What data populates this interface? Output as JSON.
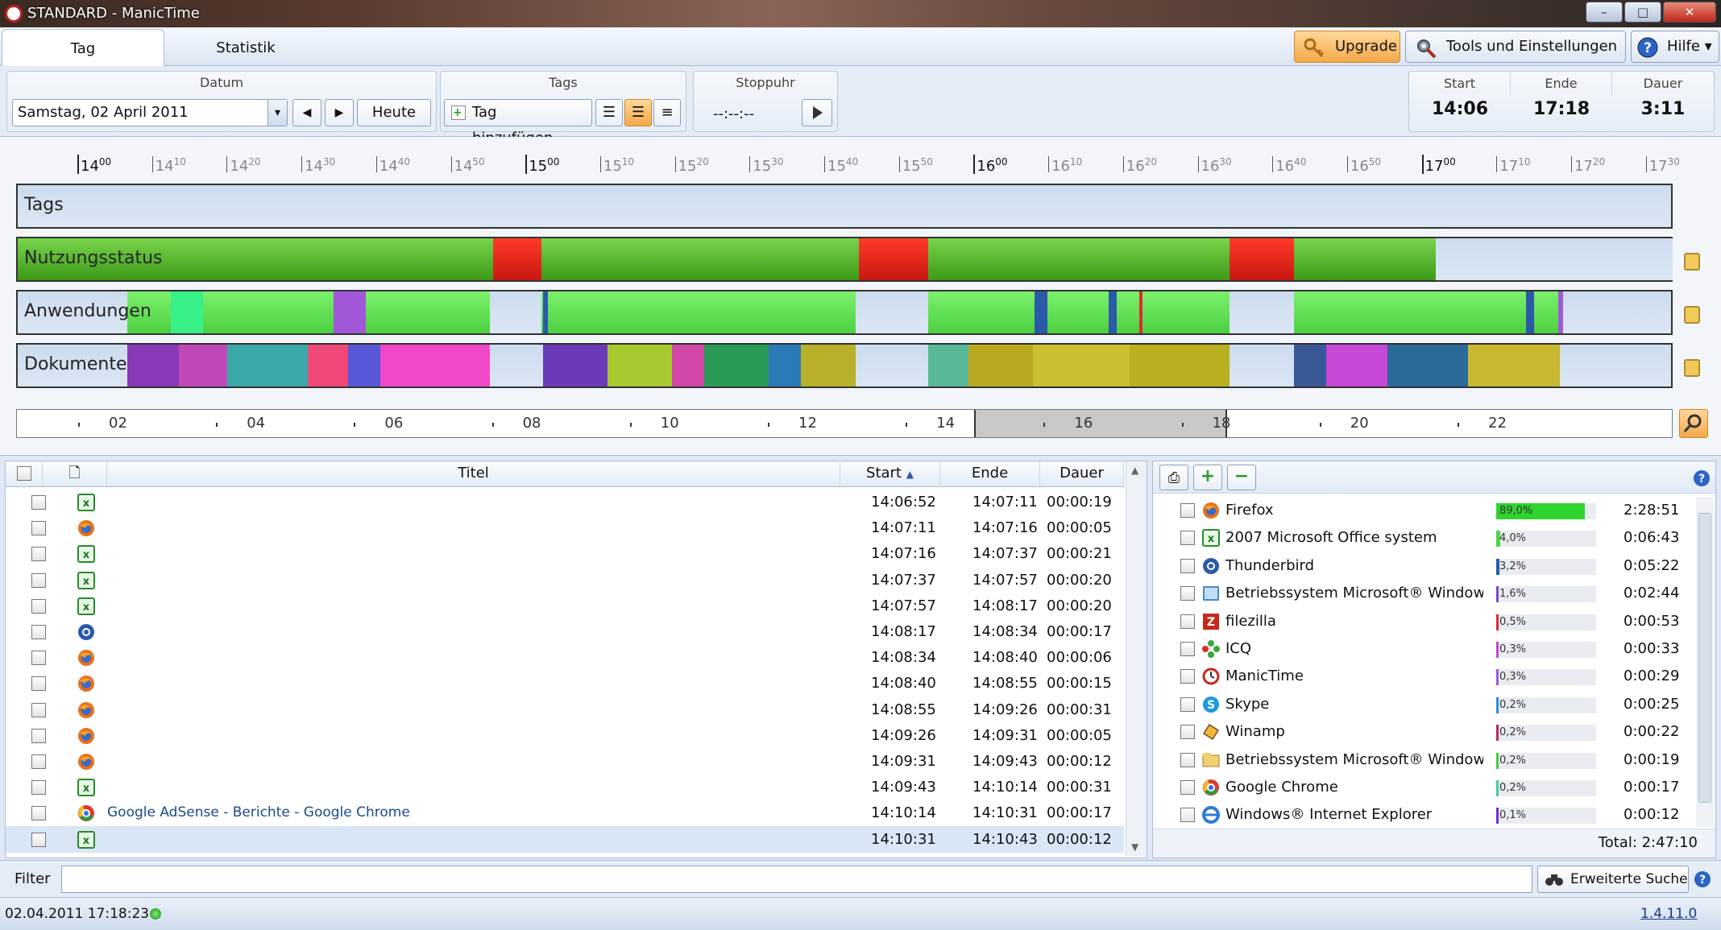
{
  "window": {
    "title": "STANDARD - ManicTime",
    "minimize": "–",
    "maximize": "□",
    "close": "✕"
  },
  "menu": {
    "tabs": [
      {
        "label": "Tag"
      },
      {
        "label": "Statistik"
      }
    ],
    "upgrade_label": "Upgrade",
    "tools_label": "Tools und Einstellungen",
    "help_label": "Hilfe",
    "dropdown_arrow": "▾"
  },
  "toolbar": {
    "datum_title": "Datum",
    "date_value": "Samstag, 02 April 2011",
    "prev": "◀",
    "next": "▶",
    "today_label": "Heute",
    "tags_title": "Tags",
    "add_tag_label": "Tag hinzufügen...",
    "stopwatch_title": "Stoppuhr",
    "stopwatch_value": "--:--:--",
    "summary": {
      "start_label": "Start",
      "start_value": "14:06",
      "end_label": "Ende",
      "end_value": "17:18",
      "duration_label": "Dauer",
      "duration_value": "3:11"
    }
  },
  "timeline": {
    "ticks": [
      {
        "h": "14",
        "m": "00",
        "major": true
      },
      {
        "h": "14",
        "m": "10"
      },
      {
        "h": "14",
        "m": "20"
      },
      {
        "h": "14",
        "m": "30"
      },
      {
        "h": "14",
        "m": "40"
      },
      {
        "h": "14",
        "m": "50"
      },
      {
        "h": "15",
        "m": "00",
        "major": true
      },
      {
        "h": "15",
        "m": "10"
      },
      {
        "h": "15",
        "m": "20"
      },
      {
        "h": "15",
        "m": "30"
      },
      {
        "h": "15",
        "m": "40"
      },
      {
        "h": "15",
        "m": "50"
      },
      {
        "h": "16",
        "m": "00",
        "major": true
      },
      {
        "h": "16",
        "m": "10"
      },
      {
        "h": "16",
        "m": "20"
      },
      {
        "h": "16",
        "m": "30"
      },
      {
        "h": "16",
        "m": "40"
      },
      {
        "h": "16",
        "m": "50"
      },
      {
        "h": "17",
        "m": "00",
        "major": true
      },
      {
        "h": "17",
        "m": "10"
      },
      {
        "h": "17",
        "m": "20"
      },
      {
        "h": "17",
        "m": "30"
      }
    ],
    "rows": {
      "tags": "Tags",
      "usage": "Nutzungsstatus",
      "apps": "Anwendungen",
      "docs": "Dokumente"
    },
    "colors": {
      "active": "#5cbf2a",
      "away": "#e8261c",
      "app_green": "#5fe05a"
    },
    "day_ruler": [
      "02",
      "04",
      "06",
      "08",
      "10",
      "12",
      "14",
      "16",
      "18",
      "20",
      "22"
    ]
  },
  "doc_table": {
    "headers": {
      "title": "Titel",
      "start": "Start",
      "end": "Ende",
      "duration": "Dauer",
      "sort": "▲"
    },
    "rows": [
      {
        "icon": "excel-icon",
        "title": "",
        "start": "14:06:52",
        "end": "14:07:11",
        "dur": "00:00:19"
      },
      {
        "icon": "firefox-icon",
        "title": "",
        "start": "14:07:11",
        "end": "14:07:16",
        "dur": "00:00:05"
      },
      {
        "icon": "excel-icon",
        "title": "",
        "start": "14:07:16",
        "end": "14:07:37",
        "dur": "00:00:21"
      },
      {
        "icon": "excel-icon",
        "title": "",
        "start": "14:07:37",
        "end": "14:07:57",
        "dur": "00:00:20"
      },
      {
        "icon": "excel-icon",
        "title": "",
        "start": "14:07:57",
        "end": "14:08:17",
        "dur": "00:00:20"
      },
      {
        "icon": "thunderbird-icon",
        "title": "",
        "start": "14:08:17",
        "end": "14:08:34",
        "dur": "00:00:17"
      },
      {
        "icon": "firefox-icon",
        "title": "",
        "start": "14:08:34",
        "end": "14:08:40",
        "dur": "00:00:06"
      },
      {
        "icon": "firefox-icon",
        "title": "",
        "start": "14:08:40",
        "end": "14:08:55",
        "dur": "00:00:15"
      },
      {
        "icon": "firefox-icon",
        "title": "",
        "start": "14:08:55",
        "end": "14:09:26",
        "dur": "00:00:31"
      },
      {
        "icon": "firefox-icon",
        "title": "",
        "start": "14:09:26",
        "end": "14:09:31",
        "dur": "00:00:05"
      },
      {
        "icon": "firefox-icon",
        "title": "",
        "start": "14:09:31",
        "end": "14:09:43",
        "dur": "00:00:12"
      },
      {
        "icon": "excel-icon",
        "title": "",
        "start": "14:09:43",
        "end": "14:10:14",
        "dur": "00:00:31"
      },
      {
        "icon": "chrome-icon",
        "title": "Google AdSense - Berichte - Google Chrome",
        "start": "14:10:14",
        "end": "14:10:31",
        "dur": "00:00:17"
      },
      {
        "icon": "excel-icon",
        "title": "",
        "start": "14:10:31",
        "end": "14:10:43",
        "dur": "00:00:12"
      }
    ]
  },
  "app_stats": {
    "rows": [
      {
        "icon": "firefox-icon",
        "name": "Firefox",
        "pct": "89,0%",
        "fraction": 0.89,
        "color": "#2fd42f",
        "dur": "2:28:51"
      },
      {
        "icon": "excel-icon",
        "name": "2007 Microsoft Office system",
        "pct": "4,0%",
        "fraction": 0.04,
        "color": "#4fd44f",
        "dur": "0:06:43"
      },
      {
        "icon": "thunderbird-icon",
        "name": "Thunderbird",
        "pct": "3,2%",
        "fraction": 0.032,
        "color": "#2a5aa8",
        "dur": "0:05:22"
      },
      {
        "icon": "windows-icon",
        "name": "Betriebssystem Microsoft® Windows®",
        "pct": "1,6%",
        "fraction": 0.016,
        "color": "#7a48c8",
        "dur": "0:02:44"
      },
      {
        "icon": "filezilla-icon",
        "name": "filezilla",
        "pct": "0,5%",
        "fraction": 0.005,
        "color": "#e02a2a",
        "dur": "0:00:53"
      },
      {
        "icon": "icq-icon",
        "name": "ICQ",
        "pct": "0,3%",
        "fraction": 0.003,
        "color": "#c048c8",
        "dur": "0:00:33"
      },
      {
        "icon": "manictime-icon",
        "name": "ManicTime",
        "pct": "0,3%",
        "fraction": 0.003,
        "color": "#9a58e8",
        "dur": "0:00:29"
      },
      {
        "icon": "skype-icon",
        "name": "Skype",
        "pct": "0,2%",
        "fraction": 0.002,
        "color": "#2a8ae8",
        "dur": "0:00:25"
      },
      {
        "icon": "winamp-icon",
        "name": "Winamp",
        "pct": "0,2%",
        "fraction": 0.002,
        "color": "#b02a6a",
        "dur": "0:00:22"
      },
      {
        "icon": "explorer-icon",
        "name": "Betriebssystem Microsoft® Windows®",
        "pct": "0,2%",
        "fraction": 0.002,
        "color": "#48c848",
        "dur": "0:00:19"
      },
      {
        "icon": "chrome-icon",
        "name": "Google Chrome",
        "pct": "0,2%",
        "fraction": 0.002,
        "color": "#48c8a8",
        "dur": "0:00:17"
      },
      {
        "icon": "ie-icon",
        "name": "Windows® Internet Explorer",
        "pct": "0,1%",
        "fraction": 0.001,
        "color": "#7a2ad8",
        "dur": "0:00:12"
      }
    ],
    "total": "Total: 2:47:10"
  },
  "filter": {
    "label": "Filter",
    "value": "",
    "advanced_label": "Erweiterte Suche"
  },
  "status": {
    "datetime": "02.04.2011 17:18:23",
    "version": "1.4.11.0"
  }
}
